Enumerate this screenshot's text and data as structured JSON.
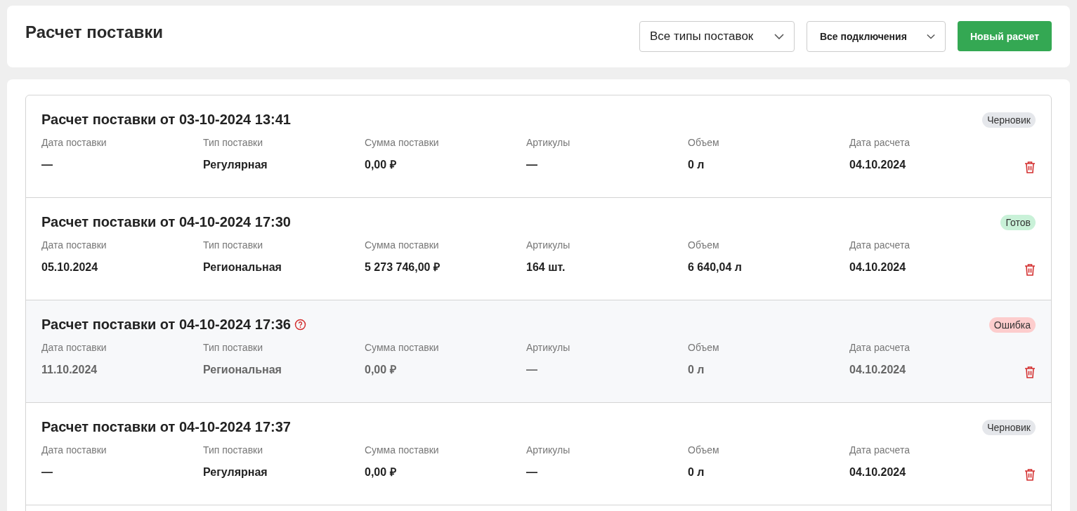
{
  "header": {
    "title": "Расчет поставки",
    "filters": [
      {
        "label": "Все типы поставок",
        "kind": "plain"
      },
      {
        "label": "Все подключения",
        "kind": "bold"
      }
    ],
    "new_button": "Новый расчет"
  },
  "calculations": [
    {
      "title": "Расчет поставки от 03-10-2024 13:41",
      "status": {
        "label": "Черновик",
        "kind": "draft"
      },
      "fields": [
        {
          "label": "Дата поставки",
          "value": "—"
        },
        {
          "label": "Тип поставки",
          "value": "Регулярная"
        },
        {
          "label": "Сумма поставки",
          "value": "0,00 ₽"
        },
        {
          "label": "Артикулы",
          "value": "—"
        },
        {
          "label": "Объем",
          "value": "0 л"
        },
        {
          "label": "Дата расчета",
          "value": "04.10.2024"
        }
      ]
    },
    {
      "title": "Расчет поставки от 04-10-2024 17:30",
      "status": {
        "label": "Готов",
        "kind": "ready"
      },
      "fields": [
        {
          "label": "Дата поставки",
          "value": "05.10.2024"
        },
        {
          "label": "Тип поставки",
          "value": "Региональная"
        },
        {
          "label": "Сумма поставки",
          "value": "5 273 746,00 ₽"
        },
        {
          "label": "Артикулы",
          "value": "164 шт."
        },
        {
          "label": "Объем",
          "value": "6 640,04 л"
        },
        {
          "label": "Дата расчета",
          "value": "04.10.2024"
        }
      ]
    },
    {
      "title": "Расчет поставки от 04-10-2024 17:36",
      "status": {
        "label": "Ошибка",
        "kind": "error"
      },
      "fields": [
        {
          "label": "Дата поставки",
          "value": "11.10.2024"
        },
        {
          "label": "Тип поставки",
          "value": "Региональная"
        },
        {
          "label": "Сумма поставки",
          "value": "0,00 ₽"
        },
        {
          "label": "Артикулы",
          "value": "—"
        },
        {
          "label": "Объем",
          "value": "0 л"
        },
        {
          "label": "Дата расчета",
          "value": "04.10.2024"
        }
      ]
    },
    {
      "title": "Расчет поставки от 04-10-2024 17:37",
      "status": {
        "label": "Черновик",
        "kind": "draft"
      },
      "fields": [
        {
          "label": "Дата поставки",
          "value": "—"
        },
        {
          "label": "Тип поставки",
          "value": "Регулярная"
        },
        {
          "label": "Сумма поставки",
          "value": "0,00 ₽"
        },
        {
          "label": "Артикулы",
          "value": "—"
        },
        {
          "label": "Объем",
          "value": "0 л"
        },
        {
          "label": "Дата расчета",
          "value": "04.10.2024"
        }
      ]
    }
  ]
}
